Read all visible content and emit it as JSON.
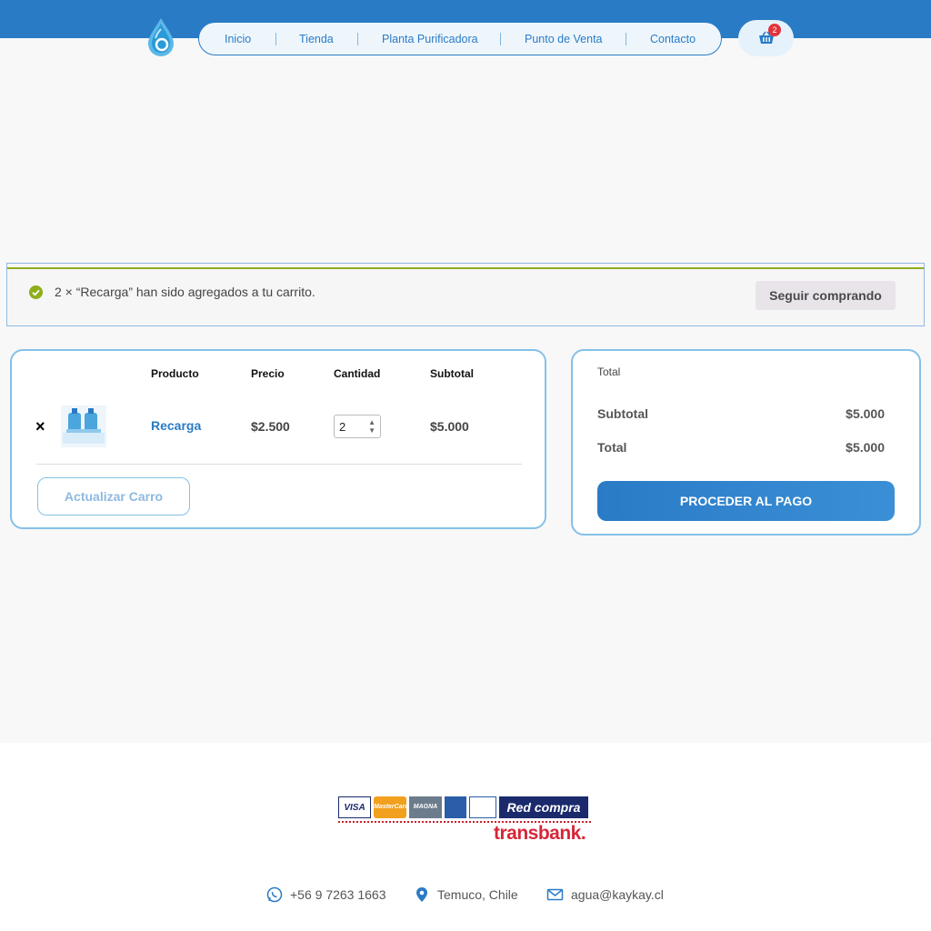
{
  "colors": {
    "primary": "#2a7bc6",
    "border_light": "#86c0e8",
    "success": "#8fae1b",
    "badge": "#e2333b",
    "transbank": "#d72638"
  },
  "nav": {
    "items": [
      "Inicio",
      "Tienda",
      "Planta Purificadora",
      "Punto de Venta",
      "Contacto"
    ],
    "cart_count": "2"
  },
  "notice": {
    "message": "2 × “Recarga” han sido agregados a tu carrito.",
    "continue_label": "Seguir comprando"
  },
  "cart": {
    "headers": {
      "product": "Producto",
      "price": "Precio",
      "quantity": "Cantidad",
      "subtotal": "Subtotal"
    },
    "row": {
      "remove": "×",
      "product": "Recarga",
      "price": "$2.500",
      "quantity": "2",
      "subtotal": "$5.000"
    },
    "update_label": "Actualizar Carro"
  },
  "totals": {
    "title": "Total",
    "subtotal_label": "Subtotal",
    "subtotal_value": "$5.000",
    "total_label": "Total",
    "total_value": "$5.000",
    "checkout_label": "PROCEDER AL PAGO"
  },
  "footer": {
    "payment": {
      "visa": "VISA",
      "mastercard": "MasterCard",
      "magna": "MAGNA",
      "redcompra": "Red compra",
      "transbank": "transbank."
    },
    "phone": "+56 9 7263 1663",
    "location": "Temuco, Chile",
    "email": "agua@kaykay.cl"
  }
}
